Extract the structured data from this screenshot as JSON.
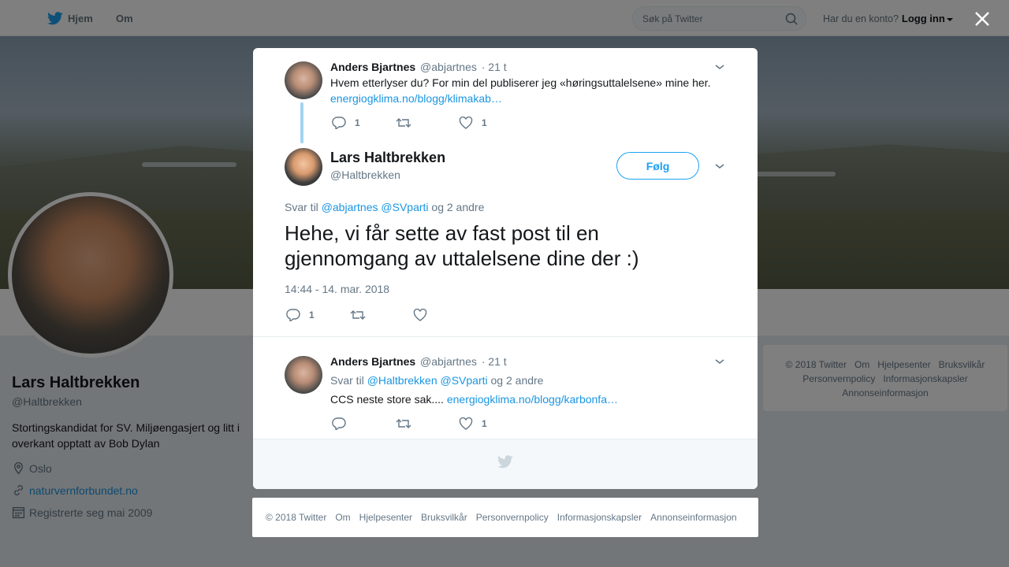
{
  "topbar": {
    "home_label": "Hjem",
    "about_label": "Om",
    "search_placeholder": "Søk på Twitter",
    "have_account": "Har du en konto?",
    "login_label": "Logg inn"
  },
  "profile": {
    "name": "Lars Haltbrekken",
    "handle": "@Haltbrekken",
    "bio": "Stortingskandidat for SV. Miljøengasjert og litt i overkant opptatt av Bob Dylan",
    "location": "Oslo",
    "website": "naturvernforbundet.no",
    "joined": "Registrerte seg mai 2009"
  },
  "side_footer": [
    "© 2018 Twitter",
    "Om",
    "Hjelpesenter",
    "Bruksvilkår",
    "Personvernpolicy",
    "Informasjonskapsler",
    "Annonseinformasjon"
  ],
  "modal": {
    "parent_tweet": {
      "name": "Anders Bjartnes",
      "handle": "@abjartnes",
      "time": "· 21 t",
      "text": "Hvem etterlyser du? For min del publiserer jeg «høringsuttalelsene» mine her.",
      "link": "energiogklima.no/blogg/klimakab…",
      "replies": "1",
      "likes": "1"
    },
    "main_tweet": {
      "name": "Lars Haltbrekken",
      "handle": "@Haltbrekken",
      "follow_label": "Følg",
      "reply_prefix": "Svar til",
      "reply_user1": "@abjartnes",
      "reply_user2": "@SVparti",
      "reply_others": "og 2 andre",
      "text": "Hehe, vi får sette av fast post til en gjennomgang av uttalelsene dine der :)",
      "timestamp": "14:44 - 14. mar. 2018",
      "replies": "1"
    },
    "reply_tweet": {
      "name": "Anders Bjartnes",
      "handle": "@abjartnes",
      "time": "· 21 t",
      "reply_prefix": "Svar til",
      "reply_user1": "@Haltbrekken",
      "reply_user2": "@SVparti",
      "reply_others": "og 2 andre",
      "text": "CCS neste store sak....",
      "link": "energiogklima.no/blogg/karbonfa…",
      "likes": "1"
    }
  },
  "bottom_footer": [
    "© 2018 Twitter",
    "Om",
    "Hjelpesenter",
    "Bruksvilkår",
    "Personvernpolicy",
    "Informasjonskapsler",
    "Annonseinformasjon"
  ],
  "colors": {
    "twitter_blue": "#1da1f2",
    "link_blue": "#1b95e0",
    "thread_line": "#a3d4f2"
  }
}
